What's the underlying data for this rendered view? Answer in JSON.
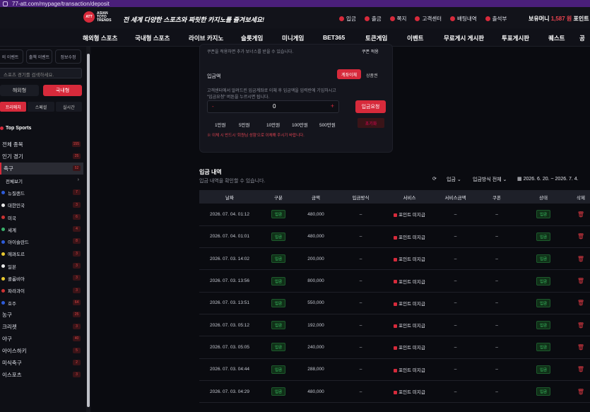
{
  "browser": {
    "url": "77-att.com/mypage/transaction/deposit"
  },
  "header": {
    "logo_mark": "ATT",
    "logo_text": "ASIAN TOTO TRENDS",
    "tagline": "전 세계 다양한 스포츠와 짜릿한 카지노를 즐겨보세요!",
    "menu": [
      "입금",
      "출금",
      "쪽지",
      "고객센터",
      "배팅내역",
      "출석부"
    ],
    "balance_label": "보유머니",
    "balance_value": "1,587 원",
    "points_label": "포인트"
  },
  "nav": [
    "해외형 스포츠",
    "국내형 스포츠",
    "라이브 카지노",
    "슬롯게임",
    "미니게임",
    "BET365",
    "토큰게임",
    "이벤트",
    "무료게시 게시판",
    "투표게시판",
    "퀘스트",
    "공"
  ],
  "sidebar": {
    "tabs": [
      "의 이벤트",
      "출첵 이벤트",
      "정보수정"
    ],
    "search_placeholder": "스포츠 경기를 검색하세요.",
    "toggle": [
      "해외형",
      "국내형"
    ],
    "subtabs": [
      "프리매치",
      "스페셜",
      "실시간"
    ],
    "section_title": "Top Sports",
    "items": [
      {
        "label": "전체 종목",
        "count": "155",
        "type": "main"
      },
      {
        "label": "인기 경기",
        "count": "25",
        "type": "main"
      },
      {
        "label": "축구",
        "count": "52",
        "type": "active"
      },
      {
        "label": "전체보기",
        "count": "",
        "type": "sub-all"
      },
      {
        "label": "뉴질랜드",
        "count": "7",
        "type": "sub",
        "color": "#2d5bd8"
      },
      {
        "label": "대한민국",
        "count": "3",
        "type": "sub",
        "color": "#e8e8e8"
      },
      {
        "label": "미국",
        "count": "6",
        "type": "sub",
        "color": "#c33"
      },
      {
        "label": "세계",
        "count": "4",
        "type": "sub",
        "color": "#3ab06b"
      },
      {
        "label": "아이슬란드",
        "count": "8",
        "type": "sub",
        "color": "#2d5bd8"
      },
      {
        "label": "에콰도르",
        "count": "3",
        "type": "sub",
        "color": "#e8c830"
      },
      {
        "label": "일본",
        "count": "3",
        "type": "sub",
        "color": "#e8e8e8"
      },
      {
        "label": "콜롬비아",
        "count": "3",
        "type": "sub",
        "color": "#e8c830"
      },
      {
        "label": "파라과이",
        "count": "3",
        "type": "sub",
        "color": "#c33"
      },
      {
        "label": "호주",
        "count": "64",
        "type": "sub",
        "color": "#2d5bd8"
      },
      {
        "label": "농구",
        "count": "25",
        "type": "main"
      },
      {
        "label": "크리켓",
        "count": "3",
        "type": "main"
      },
      {
        "label": "야구",
        "count": "40",
        "type": "main"
      },
      {
        "label": "아이스하키",
        "count": "5",
        "type": "main"
      },
      {
        "label": "미식축구",
        "count": "2",
        "type": "main"
      },
      {
        "label": "이스포츠",
        "count": "3",
        "type": "main"
      }
    ]
  },
  "deposit_form": {
    "coupon_line": "쿠폰을 적용하면 추가 보너스를 받을 수 있습니다.",
    "coupon_apply": "쿠폰 적용",
    "amount_label": "입금액",
    "tab_account": "계좌이체",
    "tab_voucher": "상품권",
    "notice_1": "고객센터에서 알려드린 입금계좌로 이체 후 입금액을 입력란에 기입하시고",
    "notice_2": "\"입금요청\" 버튼을 누르시면 됩니다.",
    "minus": "-",
    "plus": "+",
    "amount_value": "0",
    "submit": "입금요청",
    "quick": [
      "1만원",
      "5만원",
      "10만원",
      "100만원",
      "500만원"
    ],
    "reset": "초기화",
    "warning": "※ 이체 시 반드시 '회원님 성함'으로 이체해 주시기 바랍니다."
  },
  "history": {
    "title": "입금 내역",
    "subtitle": "입금 내역을 확인할 수 있습니다.",
    "filter_type": "입금",
    "filter_method": "입금방식 전체",
    "date_range": "2026. 6. 20. ~ 2026. 7. 4.",
    "columns": [
      "날짜",
      "구분",
      "금액",
      "입금방식",
      "서비스",
      "서비스금액",
      "쿠폰",
      "상태",
      "삭제"
    ],
    "rows": [
      {
        "date": "2026. 07. 04. 01:12",
        "type": "입금",
        "amount": "480,000",
        "method": "–",
        "service": "포인트 미지급",
        "svc_amount": "–",
        "coupon": "–",
        "status": "입금"
      },
      {
        "date": "2026. 07. 04. 01:01",
        "type": "입금",
        "amount": "480,000",
        "method": "–",
        "service": "포인트 미지급",
        "svc_amount": "–",
        "coupon": "–",
        "status": "입금"
      },
      {
        "date": "2026. 07. 03. 14:02",
        "type": "입금",
        "amount": "200,000",
        "method": "–",
        "service": "포인트 미지급",
        "svc_amount": "–",
        "coupon": "–",
        "status": "입금"
      },
      {
        "date": "2026. 07. 03. 13:56",
        "type": "입금",
        "amount": "800,000",
        "method": "–",
        "service": "포인트 미지급",
        "svc_amount": "–",
        "coupon": "–",
        "status": "입금"
      },
      {
        "date": "2026. 07. 03. 13:51",
        "type": "입금",
        "amount": "550,000",
        "method": "–",
        "service": "포인트 미지급",
        "svc_amount": "–",
        "coupon": "–",
        "status": "입금"
      },
      {
        "date": "2026. 07. 03. 05:12",
        "type": "입금",
        "amount": "192,000",
        "method": "–",
        "service": "포인트 미지급",
        "svc_amount": "–",
        "coupon": "–",
        "status": "입금"
      },
      {
        "date": "2026. 07. 03. 05:05",
        "type": "입금",
        "amount": "240,000",
        "method": "–",
        "service": "포인트 미지급",
        "svc_amount": "–",
        "coupon": "–",
        "status": "입금"
      },
      {
        "date": "2026. 07. 03. 04:44",
        "type": "입금",
        "amount": "288,000",
        "method": "–",
        "service": "포인트 미지급",
        "svc_amount": "–",
        "coupon": "–",
        "status": "입금"
      },
      {
        "date": "2026. 07. 03. 04:29",
        "type": "입금",
        "amount": "480,000",
        "method": "–",
        "service": "포인트 미지급",
        "svc_amount": "–",
        "coupon": "–",
        "status": "입금"
      }
    ]
  },
  "colors": {
    "accent": "#d72a3b",
    "success": "#3ed06a",
    "bg": "#0b0c12"
  }
}
